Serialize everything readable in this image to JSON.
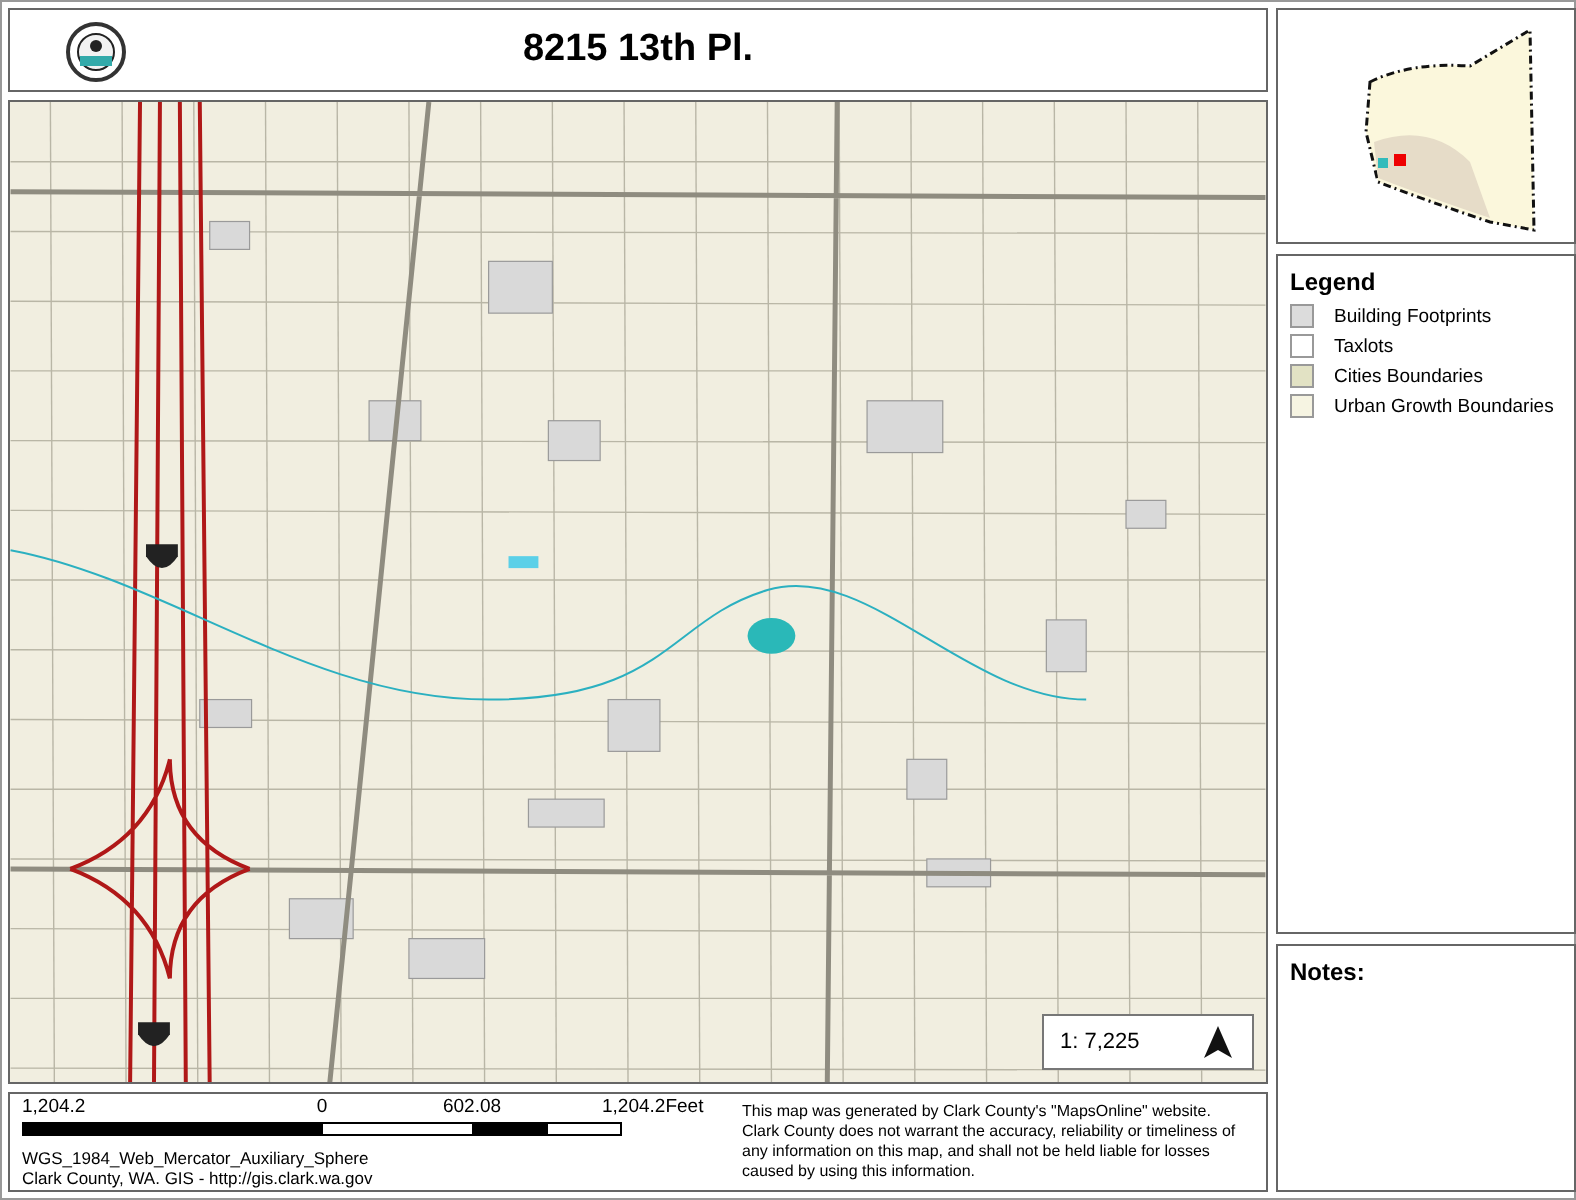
{
  "title": "8215 13th Pl.",
  "map": {
    "scale": "1: 7,225"
  },
  "legend": {
    "title": "Legend",
    "items": [
      {
        "label": "Building Footprints",
        "color": "#dcdcdc"
      },
      {
        "label": "Taxlots",
        "color": "#ffffff"
      },
      {
        "label": "Cities Boundaries",
        "color": "#e2e2c4"
      },
      {
        "label": "Urban Growth Boundaries",
        "color": "#f6f4e2"
      }
    ]
  },
  "notes": {
    "title": "Notes:"
  },
  "scale_bar": {
    "labels": [
      "1,204.2",
      "0",
      "602.08",
      "1,204.2Feet"
    ]
  },
  "projection": "WGS_1984_Web_Mercator_Auxiliary_Sphere",
  "credit": "Clark County, WA. GIS - http://gis.clark.wa.gov",
  "disclaimer": "This map was generated by Clark County's \"MapsOnline\" website. Clark County does not warrant the accuracy, reliability or timeliness of any information on this map, and shall not be held liable for losses caused by using this information."
}
